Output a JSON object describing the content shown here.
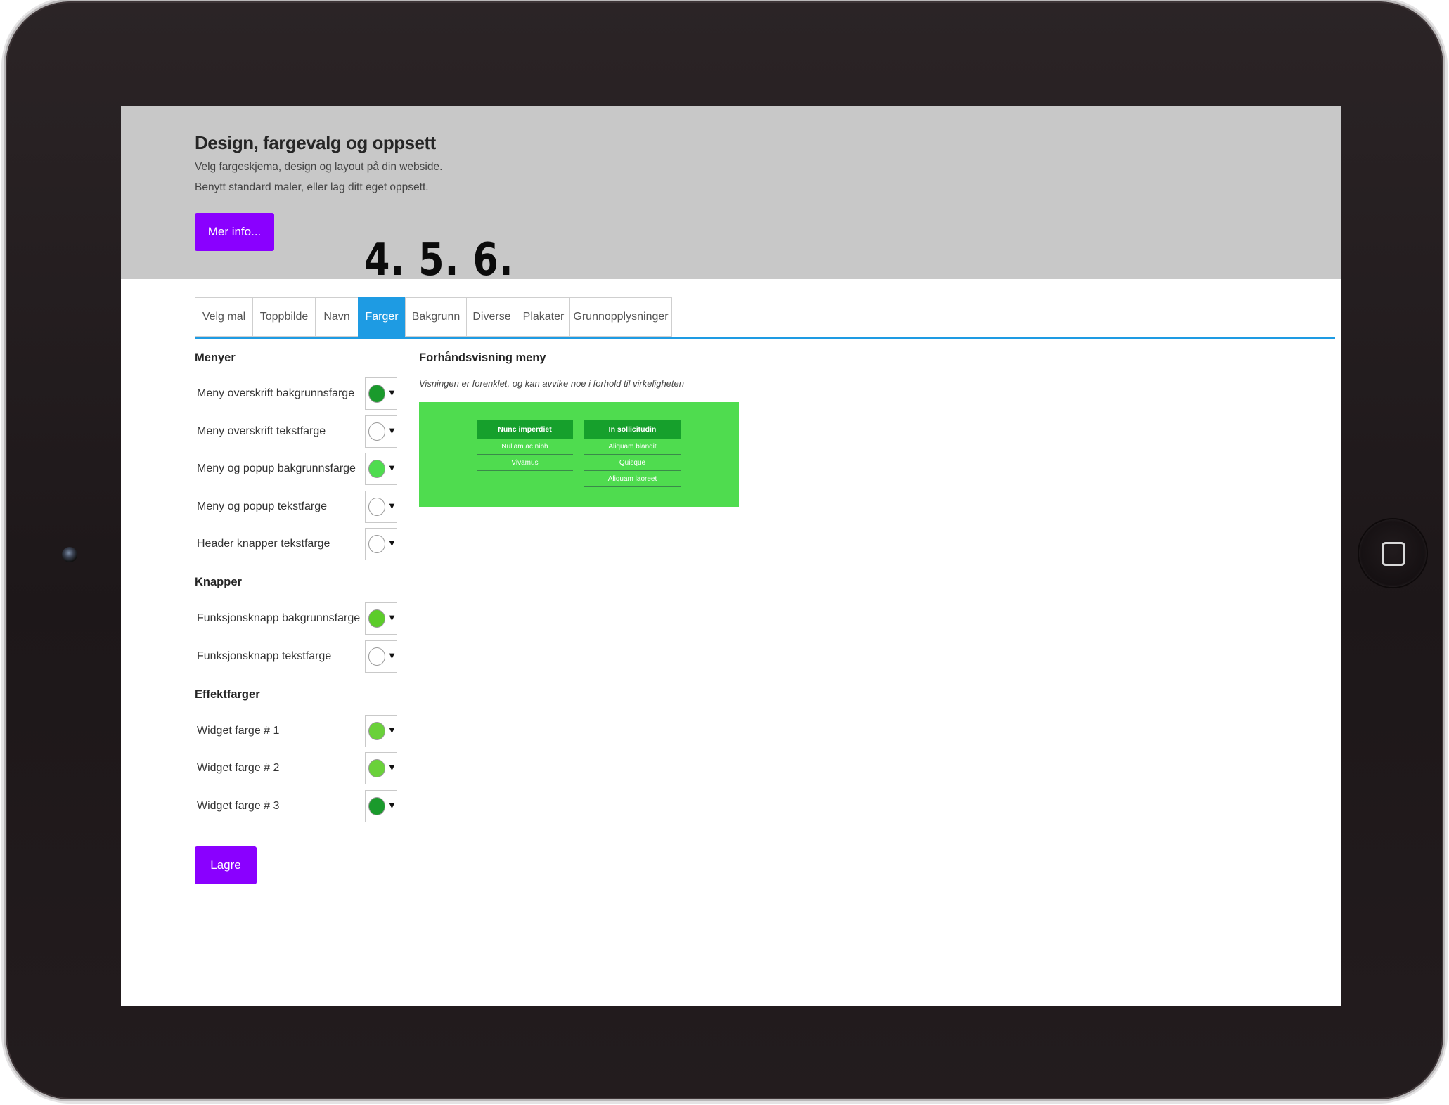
{
  "hero": {
    "title": "Design, fargevalg og oppsett",
    "description": "Velg fargeskjema, design og layout på din webside. Benytt standard maler, eller lag ditt eget oppsett.",
    "more_button": "Mer info...",
    "step_markers": "4.  5.  6."
  },
  "tabs": [
    {
      "label": "Velg mal"
    },
    {
      "label": "Toppbilde"
    },
    {
      "label": "Navn"
    },
    {
      "label": "Farger",
      "active": true
    },
    {
      "label": "Bakgrunn"
    },
    {
      "label": "Diverse"
    },
    {
      "label": "Plakater"
    },
    {
      "label": "Grunnopplysninger"
    }
  ],
  "sections": {
    "menus": {
      "title": "Menyer",
      "rows": [
        {
          "label": "Meny overskrift bakgrunnsfarge",
          "color": "#1a9a2c"
        },
        {
          "label": "Meny overskrift tekstfarge",
          "color": "#ffffff"
        },
        {
          "label": "Meny og popup bakgrunnsfarge",
          "color": "#4fdc4f"
        },
        {
          "label": "Meny og popup tekstfarge",
          "color": "#ffffff"
        },
        {
          "label": "Header knapper tekstfarge",
          "color": "#ffffff"
        }
      ]
    },
    "buttons": {
      "title": "Knapper",
      "rows": [
        {
          "label": "Funksjonsknapp bakgrunnsfarge",
          "color": "#5ccc2a"
        },
        {
          "label": "Funksjonsknapp tekstfarge",
          "color": "#ffffff"
        }
      ]
    },
    "effects": {
      "title": "Effektfarger",
      "rows": [
        {
          "label": "Widget farge # 1",
          "color": "#6ad13a"
        },
        {
          "label": "Widget farge # 2",
          "color": "#6ad13a"
        },
        {
          "label": "Widget farge # 3",
          "color": "#1a9a2c"
        }
      ]
    }
  },
  "save_button": "Lagre",
  "preview": {
    "title": "Forhåndsvisning meny",
    "note": "Visningen er forenklet, og kan avvike noe i forhold til virkeligheten",
    "background_color": "#4fdc4f",
    "header_color": "#16a02c",
    "columns": [
      {
        "header": "Nunc imperdiet",
        "items": [
          "Nullam ac nibh",
          "Vivamus"
        ]
      },
      {
        "header": "In sollicitudin",
        "items": [
          "Aliquam blandit",
          "Quisque",
          "Aliquam laoreet"
        ]
      }
    ]
  },
  "colors": {
    "accent": "#8a00ff",
    "tab_active": "#1e9be3"
  }
}
